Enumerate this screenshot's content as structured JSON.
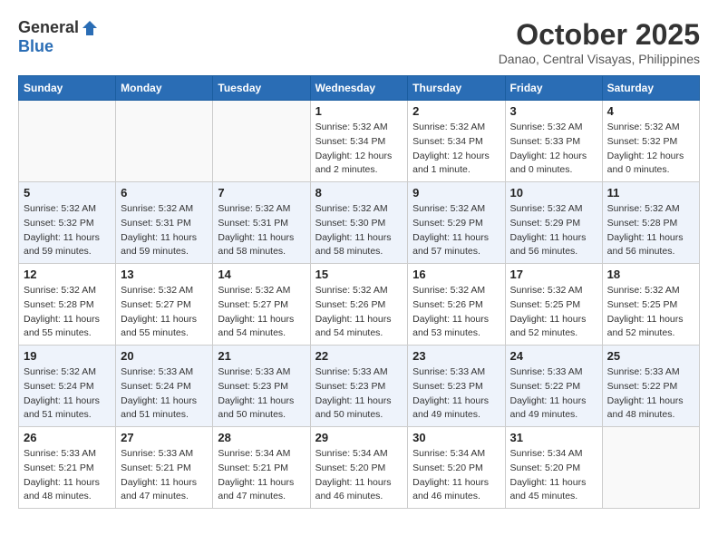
{
  "logo": {
    "general": "General",
    "blue": "Blue"
  },
  "title": {
    "month": "October 2025",
    "location": "Danao, Central Visayas, Philippines"
  },
  "headers": [
    "Sunday",
    "Monday",
    "Tuesday",
    "Wednesday",
    "Thursday",
    "Friday",
    "Saturday"
  ],
  "weeks": [
    [
      {
        "day": "",
        "info": ""
      },
      {
        "day": "",
        "info": ""
      },
      {
        "day": "",
        "info": ""
      },
      {
        "day": "1",
        "info": "Sunrise: 5:32 AM\nSunset: 5:34 PM\nDaylight: 12 hours\nand 2 minutes."
      },
      {
        "day": "2",
        "info": "Sunrise: 5:32 AM\nSunset: 5:34 PM\nDaylight: 12 hours\nand 1 minute."
      },
      {
        "day": "3",
        "info": "Sunrise: 5:32 AM\nSunset: 5:33 PM\nDaylight: 12 hours\nand 0 minutes."
      },
      {
        "day": "4",
        "info": "Sunrise: 5:32 AM\nSunset: 5:32 PM\nDaylight: 12 hours\nand 0 minutes."
      }
    ],
    [
      {
        "day": "5",
        "info": "Sunrise: 5:32 AM\nSunset: 5:32 PM\nDaylight: 11 hours\nand 59 minutes."
      },
      {
        "day": "6",
        "info": "Sunrise: 5:32 AM\nSunset: 5:31 PM\nDaylight: 11 hours\nand 59 minutes."
      },
      {
        "day": "7",
        "info": "Sunrise: 5:32 AM\nSunset: 5:31 PM\nDaylight: 11 hours\nand 58 minutes."
      },
      {
        "day": "8",
        "info": "Sunrise: 5:32 AM\nSunset: 5:30 PM\nDaylight: 11 hours\nand 58 minutes."
      },
      {
        "day": "9",
        "info": "Sunrise: 5:32 AM\nSunset: 5:29 PM\nDaylight: 11 hours\nand 57 minutes."
      },
      {
        "day": "10",
        "info": "Sunrise: 5:32 AM\nSunset: 5:29 PM\nDaylight: 11 hours\nand 56 minutes."
      },
      {
        "day": "11",
        "info": "Sunrise: 5:32 AM\nSunset: 5:28 PM\nDaylight: 11 hours\nand 56 minutes."
      }
    ],
    [
      {
        "day": "12",
        "info": "Sunrise: 5:32 AM\nSunset: 5:28 PM\nDaylight: 11 hours\nand 55 minutes."
      },
      {
        "day": "13",
        "info": "Sunrise: 5:32 AM\nSunset: 5:27 PM\nDaylight: 11 hours\nand 55 minutes."
      },
      {
        "day": "14",
        "info": "Sunrise: 5:32 AM\nSunset: 5:27 PM\nDaylight: 11 hours\nand 54 minutes."
      },
      {
        "day": "15",
        "info": "Sunrise: 5:32 AM\nSunset: 5:26 PM\nDaylight: 11 hours\nand 54 minutes."
      },
      {
        "day": "16",
        "info": "Sunrise: 5:32 AM\nSunset: 5:26 PM\nDaylight: 11 hours\nand 53 minutes."
      },
      {
        "day": "17",
        "info": "Sunrise: 5:32 AM\nSunset: 5:25 PM\nDaylight: 11 hours\nand 52 minutes."
      },
      {
        "day": "18",
        "info": "Sunrise: 5:32 AM\nSunset: 5:25 PM\nDaylight: 11 hours\nand 52 minutes."
      }
    ],
    [
      {
        "day": "19",
        "info": "Sunrise: 5:32 AM\nSunset: 5:24 PM\nDaylight: 11 hours\nand 51 minutes."
      },
      {
        "day": "20",
        "info": "Sunrise: 5:33 AM\nSunset: 5:24 PM\nDaylight: 11 hours\nand 51 minutes."
      },
      {
        "day": "21",
        "info": "Sunrise: 5:33 AM\nSunset: 5:23 PM\nDaylight: 11 hours\nand 50 minutes."
      },
      {
        "day": "22",
        "info": "Sunrise: 5:33 AM\nSunset: 5:23 PM\nDaylight: 11 hours\nand 50 minutes."
      },
      {
        "day": "23",
        "info": "Sunrise: 5:33 AM\nSunset: 5:23 PM\nDaylight: 11 hours\nand 49 minutes."
      },
      {
        "day": "24",
        "info": "Sunrise: 5:33 AM\nSunset: 5:22 PM\nDaylight: 11 hours\nand 49 minutes."
      },
      {
        "day": "25",
        "info": "Sunrise: 5:33 AM\nSunset: 5:22 PM\nDaylight: 11 hours\nand 48 minutes."
      }
    ],
    [
      {
        "day": "26",
        "info": "Sunrise: 5:33 AM\nSunset: 5:21 PM\nDaylight: 11 hours\nand 48 minutes."
      },
      {
        "day": "27",
        "info": "Sunrise: 5:33 AM\nSunset: 5:21 PM\nDaylight: 11 hours\nand 47 minutes."
      },
      {
        "day": "28",
        "info": "Sunrise: 5:34 AM\nSunset: 5:21 PM\nDaylight: 11 hours\nand 47 minutes."
      },
      {
        "day": "29",
        "info": "Sunrise: 5:34 AM\nSunset: 5:20 PM\nDaylight: 11 hours\nand 46 minutes."
      },
      {
        "day": "30",
        "info": "Sunrise: 5:34 AM\nSunset: 5:20 PM\nDaylight: 11 hours\nand 46 minutes."
      },
      {
        "day": "31",
        "info": "Sunrise: 5:34 AM\nSunset: 5:20 PM\nDaylight: 11 hours\nand 45 minutes."
      },
      {
        "day": "",
        "info": ""
      }
    ]
  ]
}
